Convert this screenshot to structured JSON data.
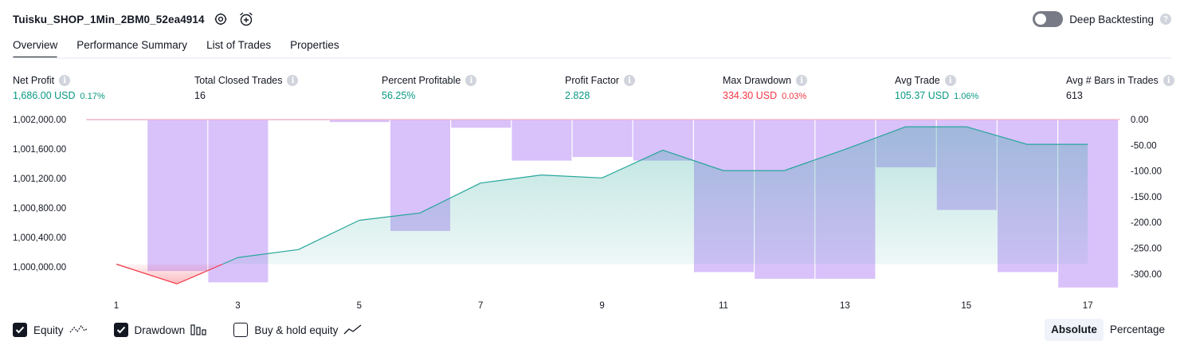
{
  "header": {
    "strategy_name": "Tuisku_SHOP_1Min_2BM0_52ea4914",
    "settings_icon": "gear-icon",
    "alert_icon": "alarm-clock-plus-icon",
    "deep_backtesting_label": "Deep Backtesting",
    "deep_backtesting_enabled": false,
    "help_symbol": "?"
  },
  "tabs": [
    {
      "label": "Overview",
      "active": true
    },
    {
      "label": "Performance Summary",
      "active": false
    },
    {
      "label": "List of Trades",
      "active": false
    },
    {
      "label": "Properties",
      "active": false
    }
  ],
  "metrics": [
    {
      "label": "Net Profit",
      "value": "1,686.00 USD",
      "pct": "0.17%",
      "color": "#089981"
    },
    {
      "label": "Total Closed Trades",
      "value": "16",
      "pct": "",
      "color": "#131722"
    },
    {
      "label": "Percent Profitable",
      "value": "56.25%",
      "pct": "",
      "color": "#089981"
    },
    {
      "label": "Profit Factor",
      "value": "2.828",
      "pct": "",
      "color": "#089981"
    },
    {
      "label": "Max Drawdown",
      "value": "334.30 USD",
      "pct": "0.03%",
      "color": "#f23645"
    },
    {
      "label": "Avg Trade",
      "value": "105.37 USD",
      "pct": "1.06%",
      "color": "#089981"
    },
    {
      "label": "Avg # Bars in Trades",
      "value": "613",
      "pct": "",
      "color": "#131722"
    }
  ],
  "info_symbol": "i",
  "chart_data": {
    "type": "line+bar",
    "x": [
      1,
      2,
      3,
      4,
      5,
      6,
      7,
      8,
      9,
      10,
      11,
      12,
      13,
      14,
      15,
      16,
      17
    ],
    "x_tick_labels": [
      "1",
      "3",
      "5",
      "7",
      "9",
      "11",
      "13",
      "15",
      "17"
    ],
    "series": [
      {
        "name": "Equity",
        "axis": "left",
        "color": "#26a69a",
        "values": [
          1000000,
          999730,
          1000090,
          1000200,
          1000600,
          1000700,
          1001110,
          1001220,
          1001180,
          1001560,
          1001280,
          1001280,
          1001570,
          1001880,
          1001880,
          1001640,
          1001640
        ]
      },
      {
        "name": "Drawdown",
        "axis": "right",
        "color": "#c29bf7",
        "values": [
          -1,
          -295,
          -317,
          -1,
          -5,
          -217,
          -16,
          -80,
          -73,
          -80,
          -297,
          -310,
          -310,
          -93,
          -176,
          -297,
          -327
        ]
      }
    ],
    "left_axis": {
      "ticks": [
        "1,002,000.00",
        "1,001,600.00",
        "1,001,200.00",
        "1,000,800.00",
        "1,000,400.00",
        "1,000,000.00"
      ],
      "range": [
        999700,
        1002000
      ]
    },
    "right_axis": {
      "ticks": [
        "0.00",
        "-50.00",
        "-100.00",
        "-150.00",
        "-200.00",
        "-250.00",
        "-300.00"
      ],
      "range": [
        -330,
        0
      ]
    },
    "grid": false
  },
  "legend": [
    {
      "label": "Equity",
      "checked": true,
      "icon": "line-icon"
    },
    {
      "label": "Drawdown",
      "checked": true,
      "icon": "bars-icon"
    },
    {
      "label": "Buy & hold equity",
      "checked": false,
      "icon": "trend-line-icon"
    }
  ],
  "scale_switch": {
    "options": [
      "Absolute",
      "Percentage"
    ],
    "selected": "Absolute"
  }
}
